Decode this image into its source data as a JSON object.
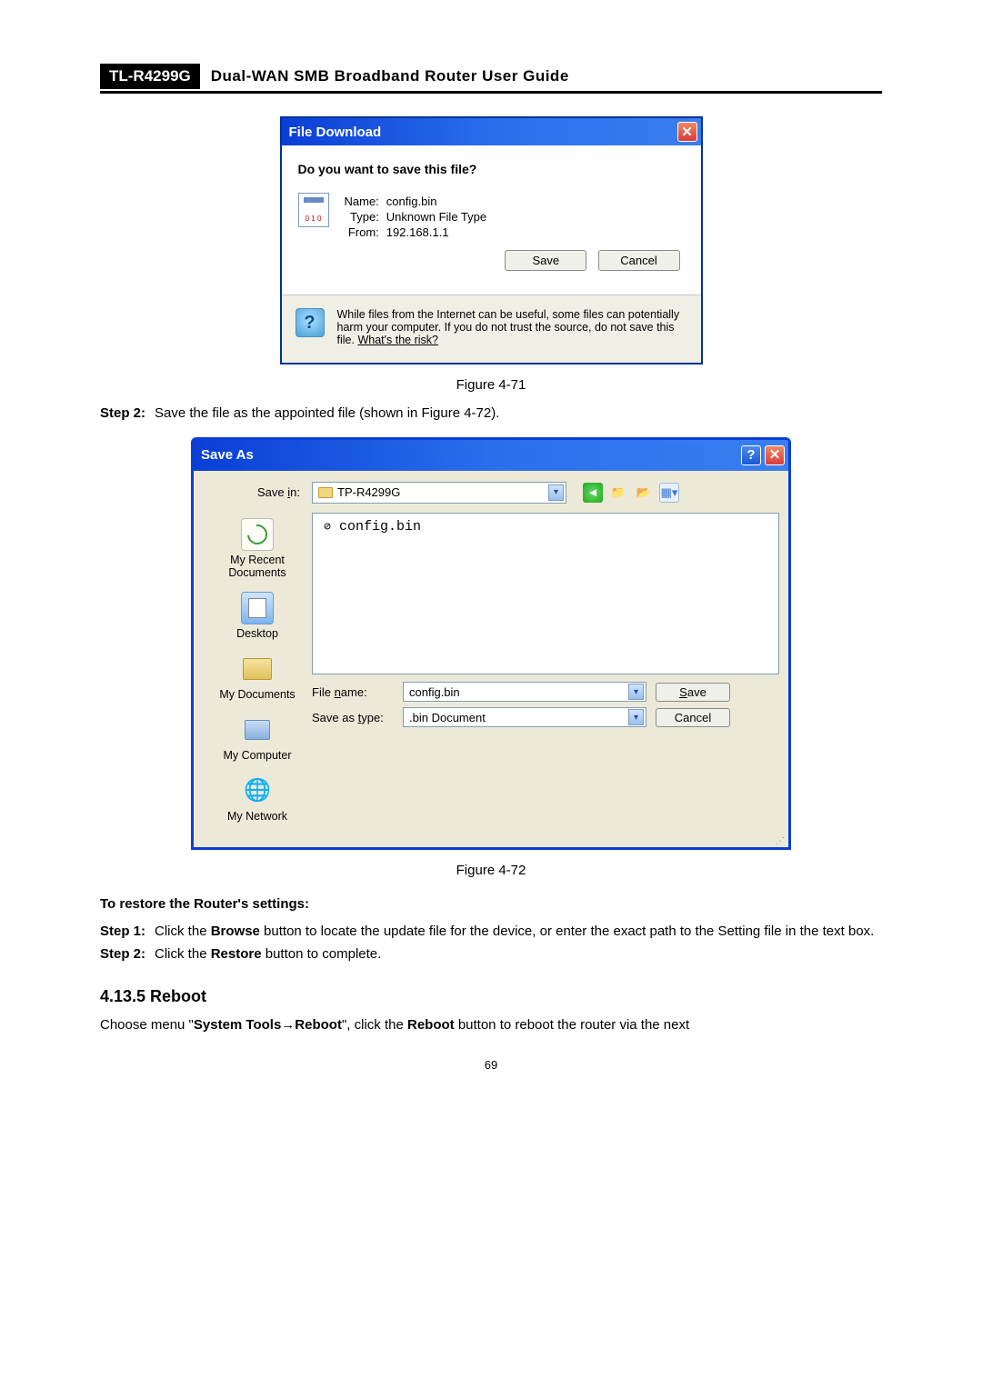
{
  "header": {
    "model": "TL-R4299G",
    "title": "Dual-WAN SMB Broadband Router User Guide"
  },
  "fileDownload": {
    "title": "File Download",
    "question": "Do you want to save this file?",
    "nameLabel": "Name:",
    "nameValue": "config.bin",
    "typeLabel": "Type:",
    "typeValue": "Unknown File Type",
    "fromLabel": "From:",
    "fromValue": "192.168.1.1",
    "save": "Save",
    "cancel": "Cancel",
    "warningPrefix": "While files from the Internet can be useful, some files can potentially harm your computer. If you do not trust the source, do not save this file. ",
    "riskLink": "What's the risk?"
  },
  "fig71": "Figure 4-71",
  "step2a_label": "Step 2:",
  "step2a_text": "Save the file as the appointed file (shown in Figure 4-72).",
  "saveAs": {
    "title": "Save As",
    "saveInLabel": "Save in:",
    "saveInValue": "TP-R4299G",
    "shortcuts": {
      "recent": "My Recent Documents",
      "desktop": "Desktop",
      "docs": "My Documents",
      "computer": "My Computer",
      "network": "My Network"
    },
    "listedFile": "config.bin",
    "fileNameLabel": "File name:",
    "fileNameValue": "config.bin",
    "saveTypeLabel": "Save as type:",
    "saveTypeValue": ".bin Document",
    "saveBtn": "Save",
    "cancelBtn": "Cancel"
  },
  "fig72": "Figure 4-72",
  "restoreHeading": "To restore the Router's settings:",
  "restoreStep1Label": "Step 1:",
  "restoreStep1a": "Click the ",
  "restoreStep1b": "Browse",
  "restoreStep1c": " button to locate the update file for the device, or enter the exact path to the Setting file in the text box.",
  "restoreStep2Label": "Step 2:",
  "restoreStep2a": "Click the ",
  "restoreStep2b": "Restore",
  "restoreStep2c": " button to complete.",
  "rebootHeading": "4.13.5  Reboot",
  "rebootP_a": "Choose menu \"",
  "rebootP_b": "System Tools→Reboot",
  "rebootP_c": "\", click the ",
  "rebootP_d": "Reboot",
  "rebootP_e": " button to reboot the router via the next",
  "pageNum": "69"
}
